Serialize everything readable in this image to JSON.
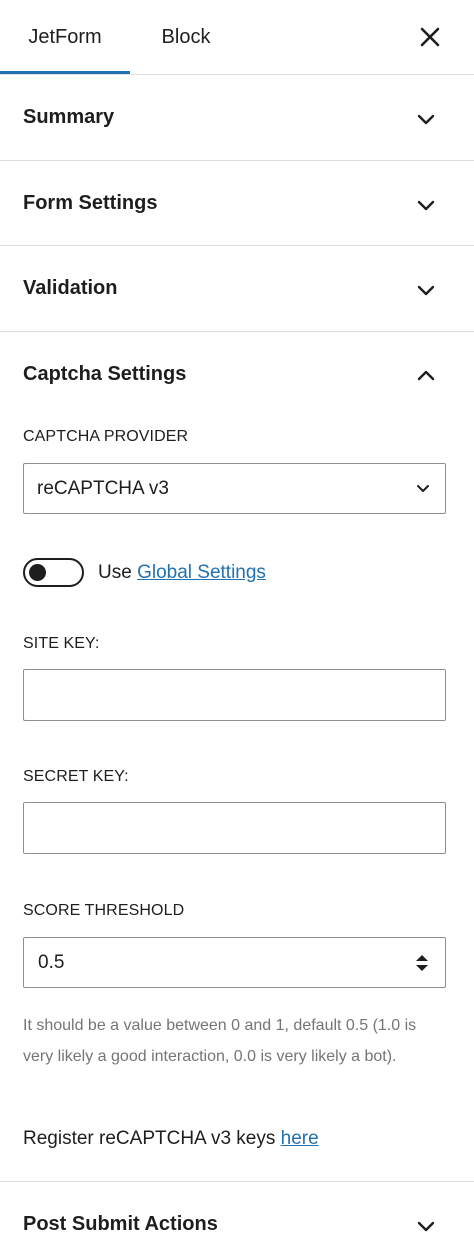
{
  "tabs": [
    {
      "label": "JetForm",
      "active": true
    },
    {
      "label": "Block",
      "active": false
    }
  ],
  "close_icon": "close-icon",
  "panels": {
    "summary": {
      "title": "Summary",
      "expanded": false
    },
    "form_settings": {
      "title": "Form Settings",
      "expanded": false
    },
    "validation": {
      "title": "Validation",
      "expanded": false
    },
    "captcha": {
      "title": "Captcha Settings",
      "expanded": true,
      "provider_label": "CAPTCHA PROVIDER",
      "provider_value": "reCAPTCHA v3",
      "toggle_text": "Use",
      "toggle_link": "Global Settings",
      "toggle_on": false,
      "site_key_label": "SITE KEY:",
      "site_key_value": "",
      "secret_key_label": "SECRET KEY:",
      "secret_key_value": "",
      "score_label": "SCORE THRESHOLD",
      "score_value": "0.5",
      "help_text": "It should be a value between 0 and 1, default 0.5 (1.0 is very likely a good interaction, 0.0 is very likely a bot).",
      "register_text": "Register reCAPTCHA v3 keys",
      "register_link": "here"
    },
    "post_submit": {
      "title": "Post Submit Actions",
      "expanded": false
    }
  },
  "colors": {
    "accent": "#2271b1",
    "text": "#1e1e1e",
    "help": "#757575",
    "border": "#8c8f94",
    "divider": "#e0e0e0"
  }
}
